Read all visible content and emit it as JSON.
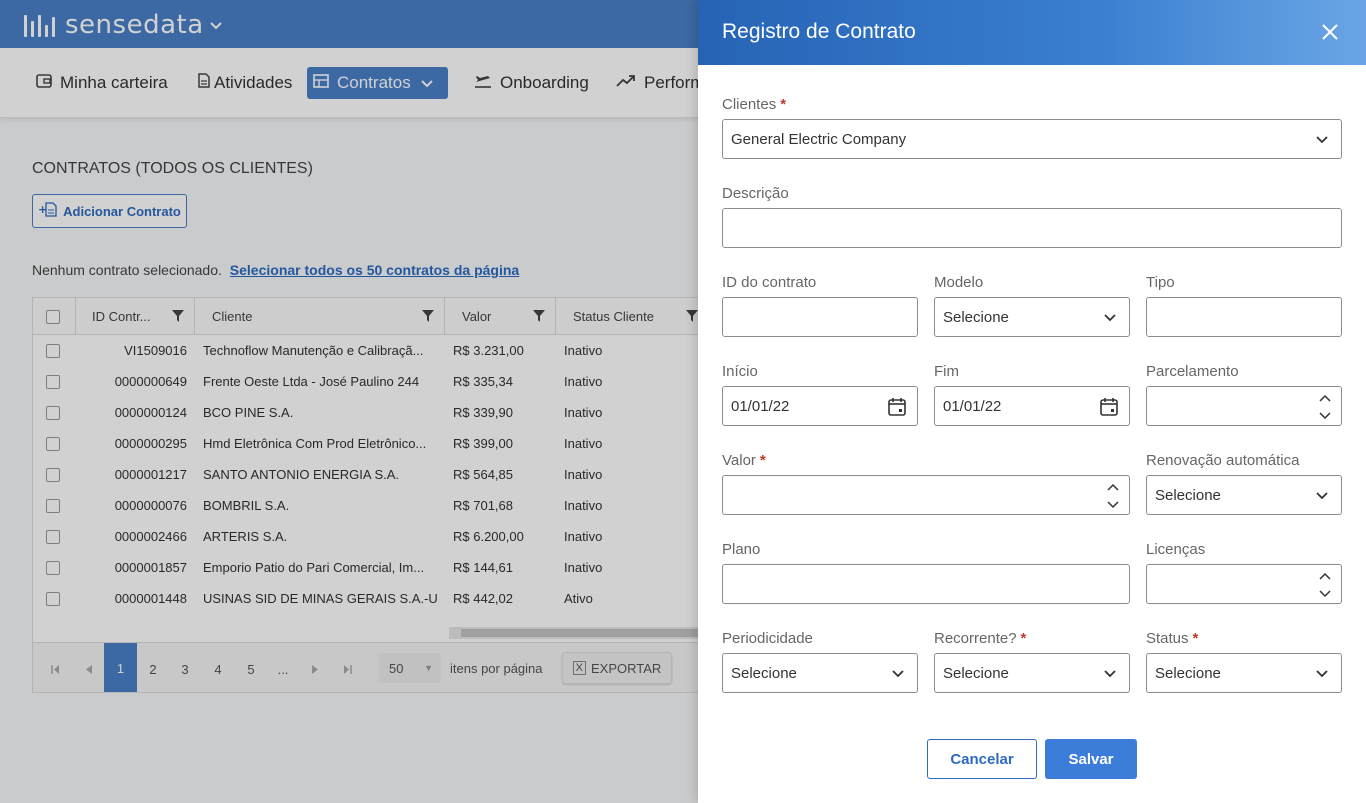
{
  "brand": {
    "name": "sensedata"
  },
  "nav": {
    "items": [
      {
        "label": "Minha carteira",
        "icon": "wallet-icon"
      },
      {
        "label": "Atividades",
        "icon": "document-icon"
      },
      {
        "label": "Contratos",
        "icon": "table-icon",
        "active": true
      },
      {
        "label": "Onboarding",
        "icon": "plane-icon"
      },
      {
        "label": "Perform",
        "icon": "trend-icon"
      }
    ]
  },
  "page": {
    "title": "CONTRATOS (TODOS OS CLIENTES)",
    "add_button": "Adicionar Contrato",
    "selection_text": "Nenhum contrato selecionado.",
    "select_all_link": "Selecionar todos os 50 contratos da página"
  },
  "grid": {
    "columns": [
      "ID Contr...",
      "Cliente",
      "Valor",
      "Status Cliente"
    ],
    "rows": [
      {
        "id": "VI1509016",
        "cliente": "Technoflow Manutenção e Calibraçã...",
        "valor": "R$ 3.231,00",
        "status": "Inativo"
      },
      {
        "id": "0000000649",
        "cliente": "Frente Oeste Ltda - José Paulino 244",
        "valor": "R$ 335,34",
        "status": "Inativo"
      },
      {
        "id": "0000000124",
        "cliente": "BCO PINE S.A.",
        "valor": "R$ 339,90",
        "status": "Inativo"
      },
      {
        "id": "0000000295",
        "cliente": "Hmd Eletrônica Com Prod Eletrônico...",
        "valor": "R$ 399,00",
        "status": "Inativo"
      },
      {
        "id": "0000001217",
        "cliente": "SANTO ANTONIO ENERGIA S.A.",
        "valor": "R$ 564,85",
        "status": "Inativo"
      },
      {
        "id": "0000000076",
        "cliente": "BOMBRIL S.A.",
        "valor": "R$ 701,68",
        "status": "Inativo"
      },
      {
        "id": "0000002466",
        "cliente": "ARTERIS S.A.",
        "valor": "R$ 6.200,00",
        "status": "Inativo"
      },
      {
        "id": "0000001857",
        "cliente": "Emporio Patio do Pari Comercial, Im...",
        "valor": "R$ 144,61",
        "status": "Inativo"
      },
      {
        "id": "0000001448",
        "cliente": "USINAS SID DE MINAS GERAIS S.A.-U...",
        "valor": "R$ 442,02",
        "status": "Ativo"
      }
    ],
    "pager": {
      "pages": [
        "1",
        "2",
        "3",
        "4",
        "5",
        "..."
      ],
      "current_page": "1",
      "per_page": "50",
      "per_page_label": "itens por página",
      "export_label": "EXPORTAR"
    }
  },
  "drawer": {
    "title": "Registro de Contrato",
    "fields": {
      "clientes": {
        "label": "Clientes",
        "value": "General Electric Company"
      },
      "descricao": {
        "label": "Descrição",
        "value": ""
      },
      "id_contrato": {
        "label": "ID do contrato",
        "value": ""
      },
      "modelo": {
        "label": "Modelo",
        "value": "Selecione"
      },
      "tipo": {
        "label": "Tipo",
        "value": ""
      },
      "inicio": {
        "label": "Início",
        "value": "01/01/22"
      },
      "fim": {
        "label": "Fim",
        "value": "01/01/22"
      },
      "parcelamento": {
        "label": "Parcelamento",
        "value": ""
      },
      "valor": {
        "label": "Valor",
        "value": ""
      },
      "renovacao": {
        "label": "Renovação automática",
        "value": "Selecione"
      },
      "plano": {
        "label": "Plano",
        "value": ""
      },
      "licencas": {
        "label": "Licenças",
        "value": ""
      },
      "periodicidade": {
        "label": "Periodicidade",
        "value": "Selecione"
      },
      "recorrente": {
        "label": "Recorrente?",
        "value": "Selecione"
      },
      "status": {
        "label": "Status",
        "value": "Selecione"
      }
    },
    "required_mark": "*",
    "cancel_label": "Cancelar",
    "save_label": "Salvar"
  },
  "colors": {
    "primary": "#4a7fc9",
    "header_gradient_start": "#2663b5",
    "header_gradient_end": "#6aa6e6",
    "required": "#c0392b"
  }
}
